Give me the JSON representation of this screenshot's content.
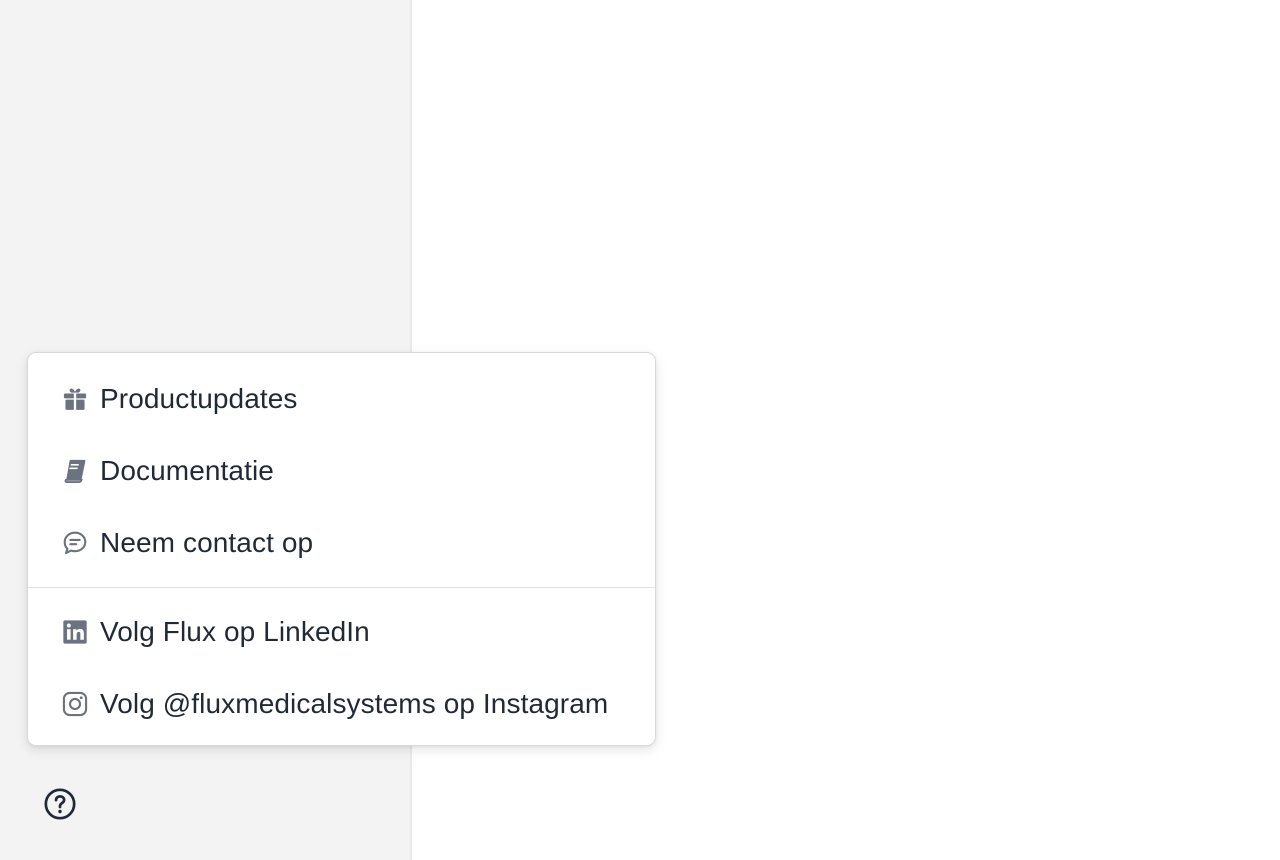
{
  "menu": {
    "groups": [
      {
        "items": [
          {
            "label": "Productupdates",
            "icon": "gift-icon"
          },
          {
            "label": "Documentatie",
            "icon": "book-icon"
          },
          {
            "label": "Neem contact op",
            "icon": "chat-bubble-icon"
          }
        ]
      },
      {
        "items": [
          {
            "label": "Volg Flux op LinkedIn",
            "icon": "linkedin-icon"
          },
          {
            "label": "Volg @fluxmedicalsystems op Instagram",
            "icon": "instagram-icon"
          }
        ]
      }
    ]
  },
  "help": {
    "icon": "help-circle-icon"
  },
  "colors": {
    "sidebar_bg": "#f3f3f3",
    "text": "#1f2937",
    "icon": "#6b7280"
  }
}
